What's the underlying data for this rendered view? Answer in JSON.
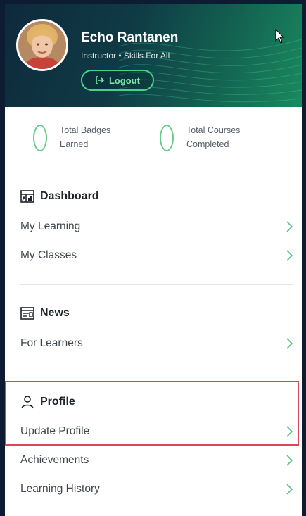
{
  "header": {
    "user_name": "Echo Rantanen",
    "user_role": "Instructor • Skills For All",
    "logout_label": "Logout"
  },
  "stats": [
    {
      "value": "0",
      "label": "Total Badges\nEarned"
    },
    {
      "value": "0",
      "label": "Total Courses\nCompleted"
    }
  ],
  "sections": {
    "dashboard": {
      "title": "Dashboard",
      "items": [
        "My Learning",
        "My Classes"
      ]
    },
    "news": {
      "title": "News",
      "items": [
        "For Learners"
      ]
    },
    "profile": {
      "title": "Profile",
      "items": [
        "Update Profile",
        "Achievements",
        "Learning History"
      ]
    }
  },
  "colors": {
    "accent": "#43d48a",
    "highlight": "#e0445a",
    "stat_zero": "#69c98a"
  }
}
